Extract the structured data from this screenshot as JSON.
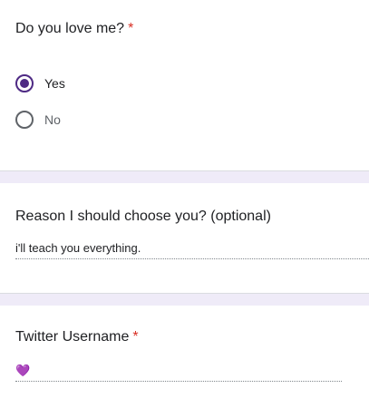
{
  "q1": {
    "title": "Do you love me?",
    "required_mark": "*",
    "options": [
      {
        "label": "Yes",
        "selected": true
      },
      {
        "label": "No",
        "selected": false
      }
    ]
  },
  "q2": {
    "title": "Reason I should choose you? (optional)",
    "answer": "i'll teach you everything."
  },
  "q3": {
    "title": "Twitter Username",
    "required_mark": "*",
    "answer": "💜"
  },
  "colors": {
    "accent": "#4e2a84",
    "required": "#d93025",
    "band": "#efebf8"
  }
}
